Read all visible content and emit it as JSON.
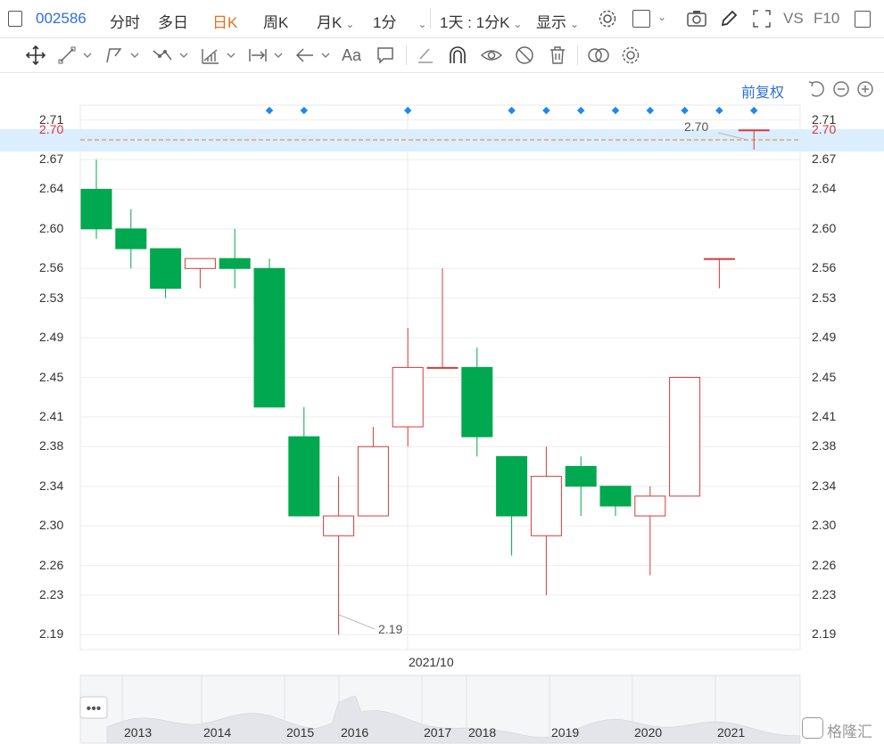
{
  "topbar": {
    "code": "002586",
    "items": [
      {
        "label": "分时"
      },
      {
        "label": "多日"
      },
      {
        "label": "日K",
        "active": true
      },
      {
        "label": "周K"
      },
      {
        "label": "月K"
      },
      {
        "label": "1分"
      },
      {
        "label": "1天 : 1分K"
      },
      {
        "label": "显示"
      }
    ],
    "vs_label": "VS",
    "f10_label": "F10"
  },
  "toolbar": {
    "icons": [
      "move-icon",
      "line-icon",
      "polyline-icon",
      "wave-icon",
      "measure-icon",
      "range-icon",
      "arrow-icon",
      "text-icon",
      "note-icon",
      "pen-icon",
      "magnet-icon",
      "eye-icon",
      "hide-icon",
      "trash-icon",
      "link-icon",
      "settings-icon"
    ],
    "text_tool_label": "Aa"
  },
  "price_mode_label": "前复权",
  "chart_data": {
    "type": "candlestick",
    "current_price_label": "2.70",
    "max_label": "2.70",
    "min_label": "2.19",
    "y_ticks": [
      "2.71",
      "2.70",
      "2.67",
      "2.64",
      "2.60",
      "2.56",
      "2.53",
      "2.49",
      "2.45",
      "2.41",
      "2.38",
      "2.34",
      "2.30",
      "2.26",
      "2.23",
      "2.19"
    ],
    "ylim": [
      2.175,
      2.725
    ],
    "x_marker_label": "2021/10",
    "candles": [
      {
        "open": 2.64,
        "close": 2.6,
        "high": 2.67,
        "low": 2.59
      },
      {
        "open": 2.6,
        "close": 2.58,
        "high": 2.62,
        "low": 2.56
      },
      {
        "open": 2.58,
        "close": 2.54,
        "high": 2.58,
        "low": 2.53
      },
      {
        "open": 2.56,
        "close": 2.57,
        "high": 2.57,
        "low": 2.54
      },
      {
        "open": 2.57,
        "close": 2.56,
        "high": 2.6,
        "low": 2.54
      },
      {
        "open": 2.56,
        "close": 2.42,
        "high": 2.57,
        "low": 2.42
      },
      {
        "open": 2.39,
        "close": 2.31,
        "high": 2.42,
        "low": 2.31
      },
      {
        "open": 2.29,
        "close": 2.31,
        "high": 2.35,
        "low": 2.19
      },
      {
        "open": 2.31,
        "close": 2.38,
        "high": 2.4,
        "low": 2.31
      },
      {
        "open": 2.4,
        "close": 2.46,
        "high": 2.5,
        "low": 2.38
      },
      {
        "open": 2.46,
        "close": 2.46,
        "high": 2.56,
        "low": 2.46
      },
      {
        "open": 2.46,
        "close": 2.39,
        "high": 2.48,
        "low": 2.37
      },
      {
        "open": 2.37,
        "close": 2.31,
        "high": 2.37,
        "low": 2.27
      },
      {
        "open": 2.29,
        "close": 2.35,
        "high": 2.38,
        "low": 2.23
      },
      {
        "open": 2.36,
        "close": 2.34,
        "high": 2.37,
        "low": 2.31
      },
      {
        "open": 2.34,
        "close": 2.32,
        "high": 2.34,
        "low": 2.31
      },
      {
        "open": 2.31,
        "close": 2.33,
        "high": 2.34,
        "low": 2.25
      },
      {
        "open": 2.33,
        "close": 2.45,
        "high": 2.45,
        "low": 2.33
      },
      {
        "open": 2.57,
        "close": 2.57,
        "high": 2.57,
        "low": 2.54
      },
      {
        "open": 2.7,
        "close": 2.7,
        "high": 2.7,
        "low": 2.68
      }
    ],
    "event_markers": [
      5,
      6,
      9,
      12,
      13,
      14,
      15,
      16,
      17,
      18,
      19
    ],
    "navigator_years": [
      "2013",
      "2014",
      "2015",
      "2016",
      "2017",
      "2018",
      "2019",
      "2020",
      "2021"
    ]
  },
  "colors": {
    "up": "#d83a3a",
    "down": "#00a84f",
    "marker": "#1e88f0",
    "dash": "#e8964a"
  },
  "watermark": "格隆汇"
}
